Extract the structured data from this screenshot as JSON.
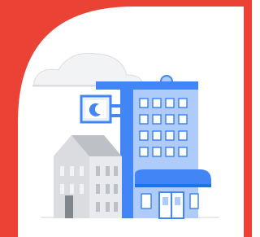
{
  "illustration": {
    "subject": "hotel-building-icon",
    "colors": {
      "frame_red": "#EA4335",
      "card_white": "#FFFFFF",
      "cloud": "#F1F3F4",
      "cloud_outline": "#DADCE0",
      "blue_primary": "#4285F4",
      "blue_light": "#AECBFA",
      "blue_pale": "#E8F0FE",
      "blue_dark": "#1A73E8",
      "gray_light": "#DADCE0",
      "gray_mid": "#BDC1C6",
      "gray_dark": "#80868B",
      "ground": "#E8EAED"
    },
    "icons": [
      "cloud-icon",
      "moon-icon",
      "hotel-sign-icon",
      "awning-icon",
      "door-icon"
    ]
  }
}
